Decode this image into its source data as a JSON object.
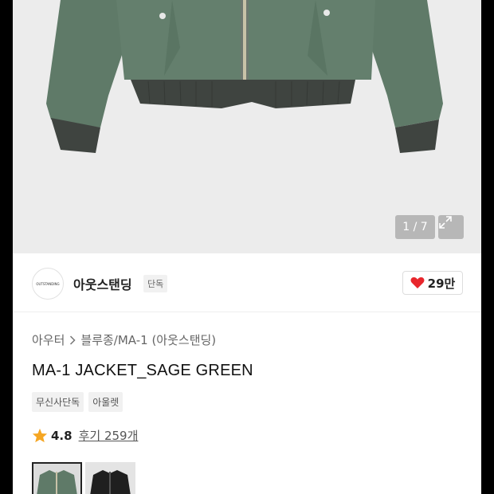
{
  "gallery": {
    "counter": "1 / 7",
    "icons": {
      "expand": "expand-icon"
    }
  },
  "brand": {
    "logo_text": "OUTSTANDING",
    "name": "아웃스탠딩",
    "badge": "단독",
    "likes": "29만"
  },
  "product": {
    "breadcrumb": [
      "아우터",
      "블루종/MA-1 (아웃스탠딩)"
    ],
    "title": "MA-1 JACKET_SAGE GREEN",
    "tags": [
      "무신사단독",
      "아울렛"
    ],
    "rating": "4.8",
    "reviews": "후기 259개"
  },
  "colors": {
    "jacket": "#5f7a68",
    "rib": "#3f4440",
    "heart": "#e8262c",
    "star": "#f5a623"
  }
}
